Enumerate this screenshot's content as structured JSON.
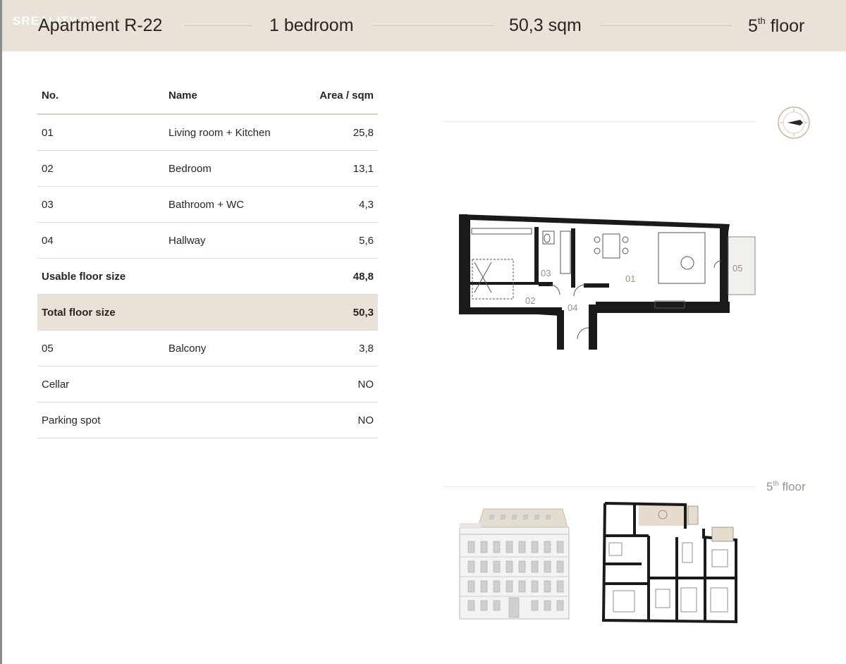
{
  "header": {
    "apartment": "Apartment R-22",
    "bedrooms": "1 bedroom",
    "area": "50,3 sqm",
    "floor_number": "5",
    "floor_suffix": "th",
    "floor_word": "floor",
    "watermark": "SREALITY.CZ"
  },
  "table": {
    "headers": {
      "no": "No.",
      "name": "Name",
      "area": "Area / sqm"
    },
    "rows": [
      {
        "no": "01",
        "name": "Living room + Kitchen",
        "area": "25,8"
      },
      {
        "no": "02",
        "name": "Bedroom",
        "area": "13,1"
      },
      {
        "no": "03",
        "name": "Bathroom + WC",
        "area": "4,3"
      },
      {
        "no": "04",
        "name": "Hallway",
        "area": "5,6"
      }
    ],
    "usable": {
      "label": "Usable floor size",
      "area": "48,8"
    },
    "total": {
      "label": "Total floor size",
      "area": "50,3"
    },
    "balcony": {
      "no": "05",
      "name": "Balcony",
      "area": "3,8"
    },
    "cellar": {
      "label": "Cellar",
      "value": "NO"
    },
    "parking": {
      "label": "Parking spot",
      "value": "NO"
    }
  },
  "plan": {
    "labels": {
      "r01": "01",
      "r02": "02",
      "r03": "03",
      "r04": "04",
      "r05": "05"
    }
  },
  "floor_caption": {
    "number": "5",
    "suffix": "th",
    "word": "floor"
  },
  "colors": {
    "header_bg": "#e9e2d8",
    "shade_row": "#e9e2d8",
    "compass": "#b9a78f",
    "wall": "#1a1a1a"
  }
}
